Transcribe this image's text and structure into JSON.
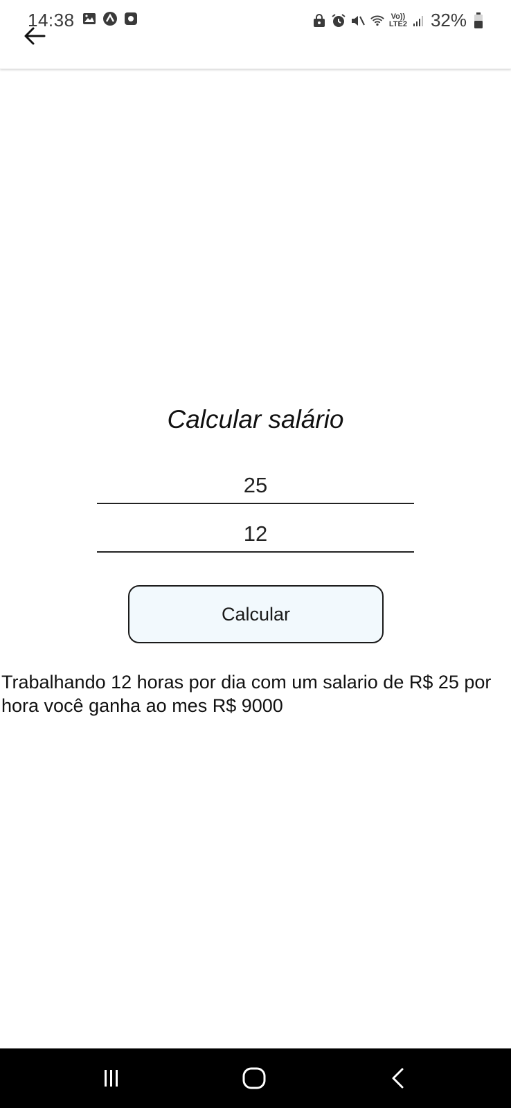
{
  "status_bar": {
    "time": "14:38",
    "battery": "32%",
    "network_label_top": "Vo))",
    "network_label_bottom": "LTE2"
  },
  "main": {
    "title": "Calcular salário",
    "hourly_wage_value": "25",
    "hours_per_day_value": "12",
    "calculate_button_label": "Calcular",
    "result_text": "Trabalhando 12 horas por dia com um salario de R$ 25 por hora você ganha ao mes R$ 9000"
  },
  "icons": {
    "back": "arrow-left-icon",
    "nav_recents": "recents-icon",
    "nav_home": "home-icon",
    "nav_back": "chevron-left-icon"
  },
  "colors": {
    "button_background": "#f2f9fd",
    "navbar_background": "#000000"
  }
}
